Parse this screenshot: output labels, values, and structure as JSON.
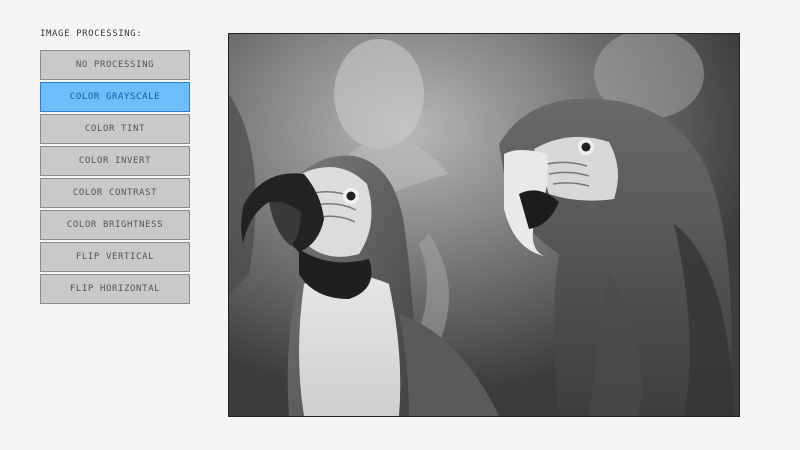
{
  "panel": {
    "title": "IMAGE PROCESSING:",
    "buttons": [
      {
        "label": "NO PROCESSING",
        "active": false
      },
      {
        "label": "COLOR GRAYSCALE",
        "active": true
      },
      {
        "label": "COLOR TINT",
        "active": false
      },
      {
        "label": "COLOR INVERT",
        "active": false
      },
      {
        "label": "COLOR CONTRAST",
        "active": false
      },
      {
        "label": "COLOR BRIGHTNESS",
        "active": false
      },
      {
        "label": "FLIP VERTICAL",
        "active": false
      },
      {
        "label": "FLIP HORIZONTAL",
        "active": false
      }
    ]
  },
  "colors": {
    "background": "#f5f5f5",
    "button": "#c9c9c9",
    "button_active": "#6fbefc",
    "button_active_text": "#0f5da8"
  },
  "viewer": {
    "subject": "two macaw parrots (grayscale)"
  }
}
